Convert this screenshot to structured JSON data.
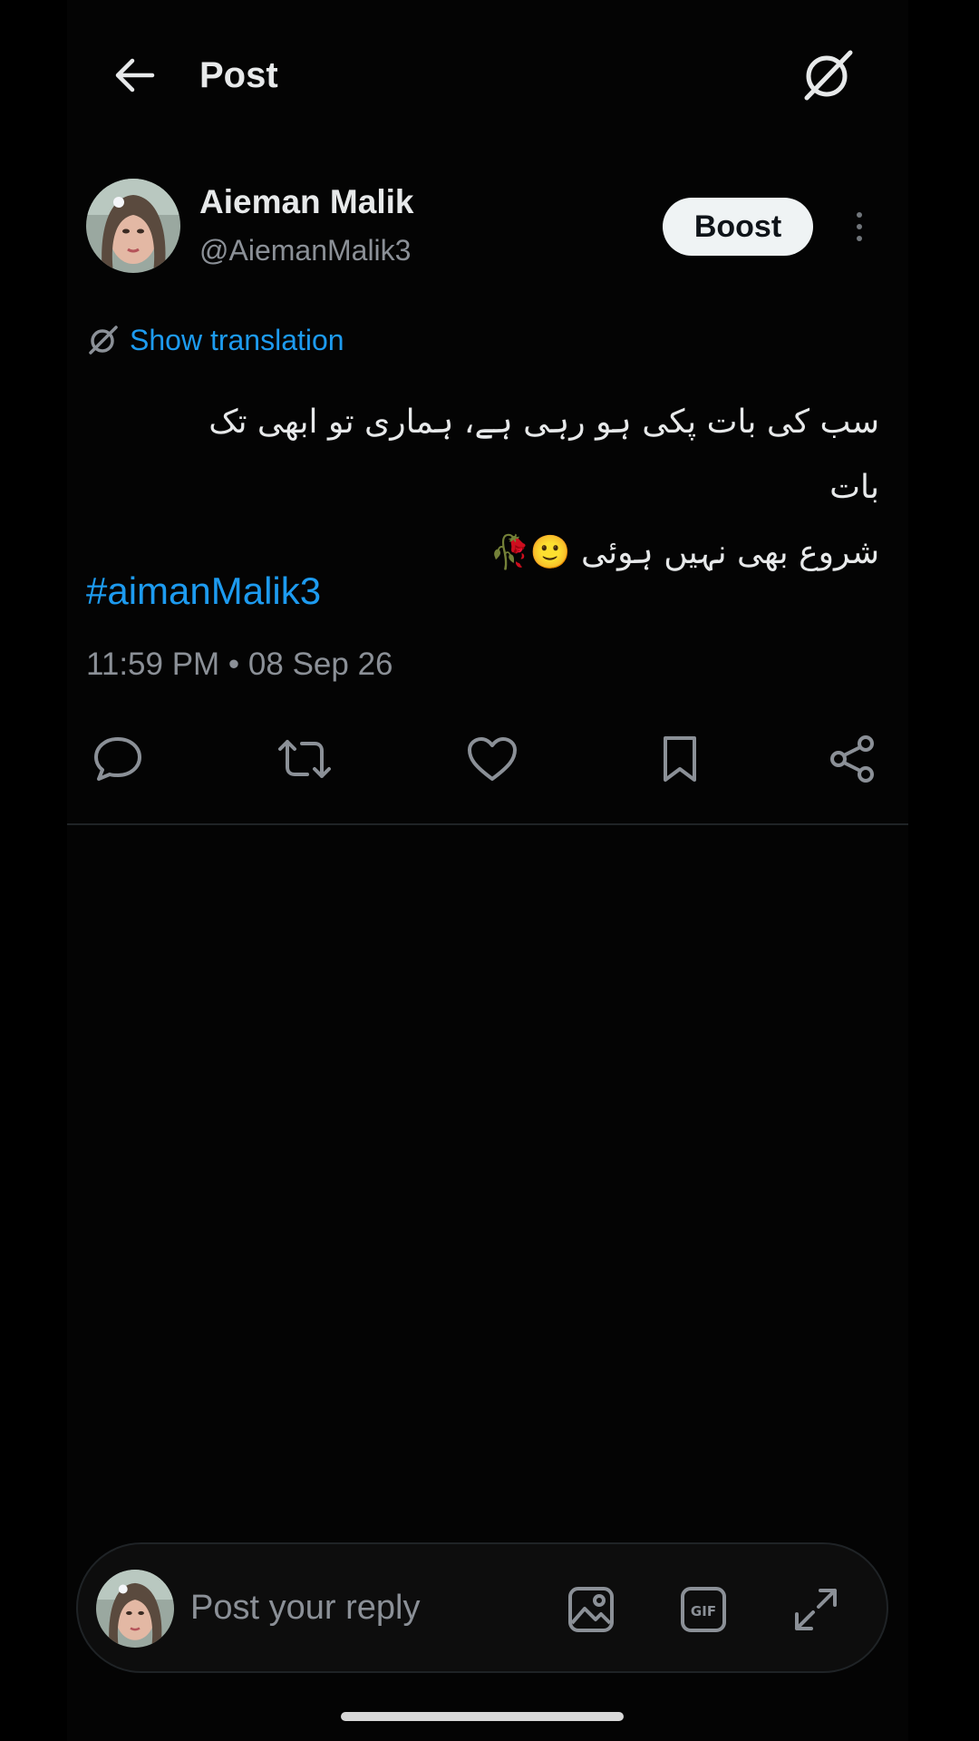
{
  "header": {
    "title": "Post"
  },
  "author": {
    "name": "Aieman Malik",
    "handle": "@AiemanMalik3",
    "boost_label": "Boost"
  },
  "translation": {
    "label": "Show translation"
  },
  "post": {
    "text_line1": "سب کی بات پکی ہو رہی ہے، ہماری تو ابھی تک بات",
    "text_line2": "شروع بھی نہیں ہوئی 🙂🥀",
    "hashtag": "#aimanMalik3",
    "timestamp": "11:59 PM • 08 Sep 26"
  },
  "actions": [
    "reply-icon",
    "repost-icon",
    "like-icon",
    "bookmark-icon",
    "share-icon"
  ],
  "composer": {
    "placeholder": "Post your reply"
  },
  "colors": {
    "accent": "#1d9bf0",
    "background": "#000000",
    "text": "#e7e9ea",
    "muted": "#8b9097"
  }
}
